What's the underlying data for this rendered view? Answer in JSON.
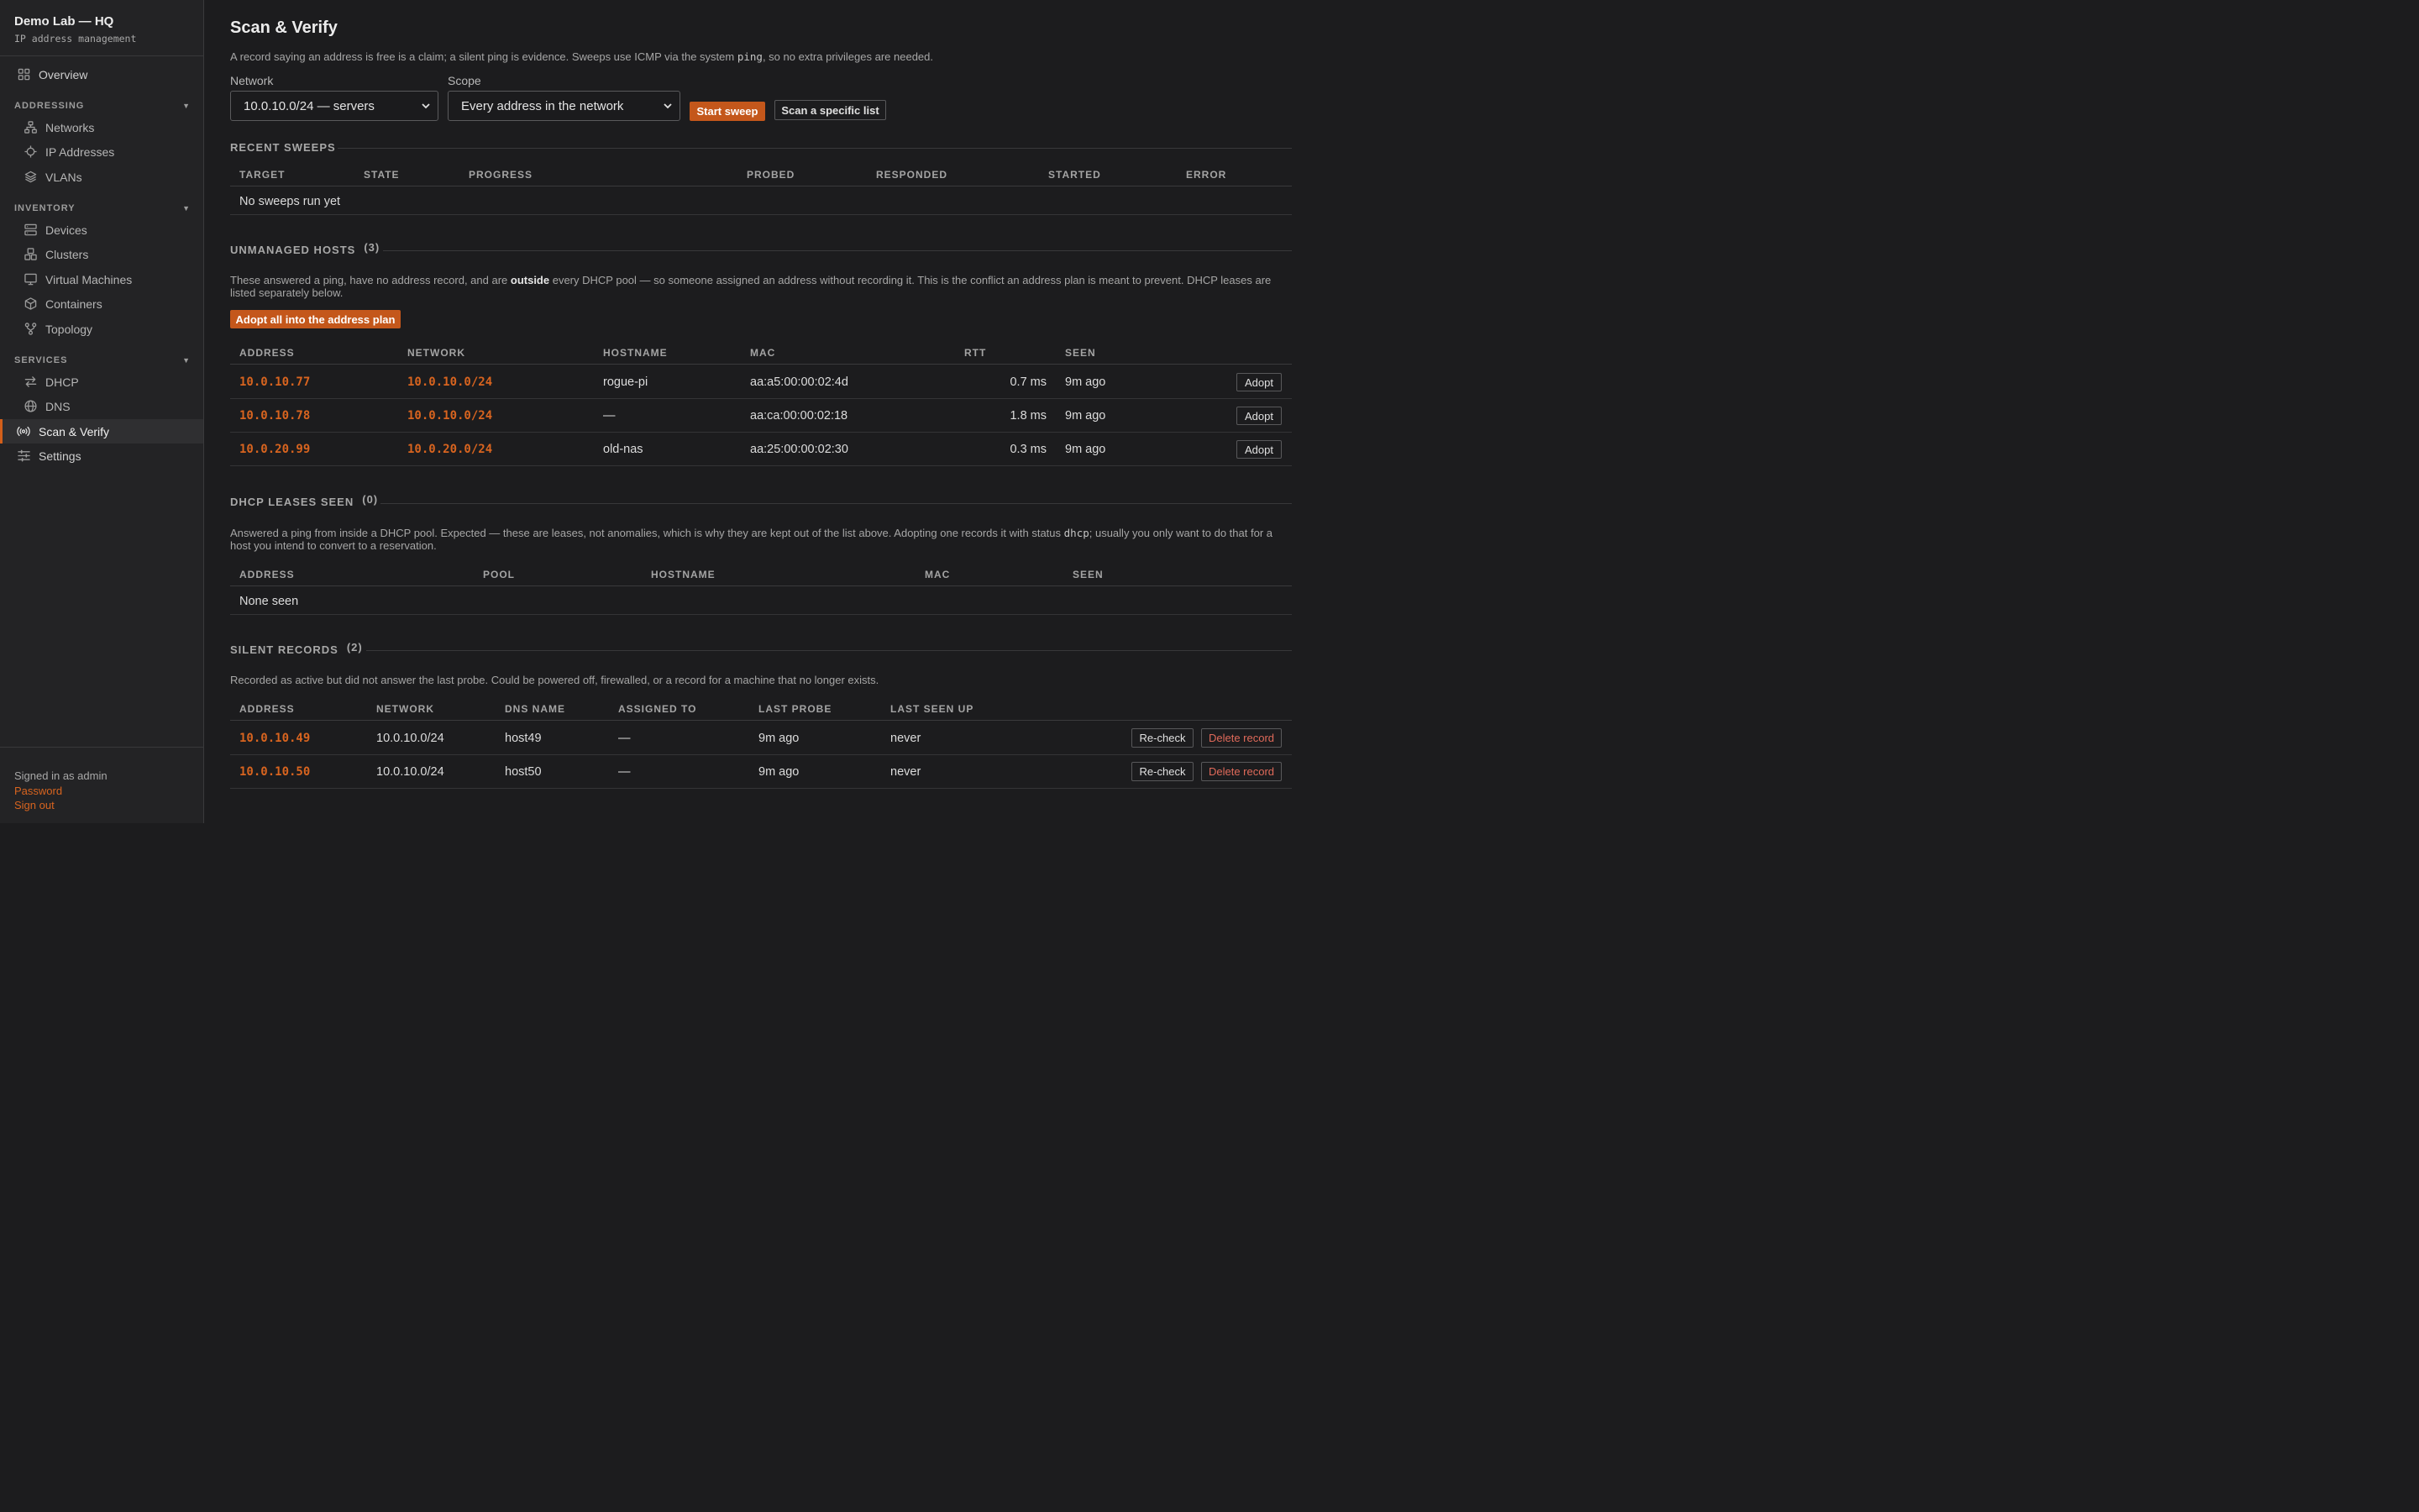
{
  "app": {
    "title": "Demo Lab — HQ",
    "subtitle": "IP address management"
  },
  "sidebar": {
    "overview": "Overview",
    "sections": {
      "addressing": "ADDRESSING",
      "inventory": "INVENTORY",
      "services": "SERVICES"
    },
    "caret": "▼",
    "items": {
      "networks": "Networks",
      "ip_addresses": "IP Addresses",
      "vlans": "VLANs",
      "devices": "Devices",
      "clusters": "Clusters",
      "virtual_machines": "Virtual Machines",
      "containers": "Containers",
      "topology": "Topology",
      "dhcp": "DHCP",
      "dns": "DNS",
      "scan_verify": "Scan & Verify",
      "settings": "Settings"
    },
    "footer": {
      "signed_in": "Signed in as admin",
      "password": "Password",
      "sign_out": "Sign out"
    }
  },
  "page": {
    "title": "Scan & Verify",
    "intro_pre": "A record saying an address is free is a claim; a silent ping is evidence. Sweeps use ICMP via the system ",
    "intro_code": "ping",
    "intro_post": ", so no extra privileges are needed.",
    "network_label": "Network",
    "network_value": "10.0.10.0/24 — servers",
    "scope_label": "Scope",
    "scope_value": "Every address in the network",
    "start_sweep": "Start sweep",
    "scan_list": "Scan a specific list"
  },
  "recent_sweeps": {
    "title": "RECENT SWEEPS",
    "columns": [
      "TARGET",
      "STATE",
      "PROGRESS",
      "PROBED",
      "RESPONDED",
      "STARTED",
      "ERROR"
    ],
    "empty": "No sweeps run yet"
  },
  "unmanaged": {
    "title": "UNMANAGED HOSTS",
    "count": "(3)",
    "desc_pre": "These answered a ping, have no address record, and are ",
    "desc_bold": "outside",
    "desc_post": " every DHCP pool — so someone assigned an address without recording it. This is the conflict an address plan is meant to prevent. DHCP leases are listed separately below.",
    "adopt_all": "Adopt all into the address plan",
    "columns": [
      "ADDRESS",
      "NETWORK",
      "HOSTNAME",
      "MAC",
      "RTT",
      "SEEN"
    ],
    "adopt_label": "Adopt",
    "rows": [
      {
        "address": "10.0.10.77",
        "network": "10.0.10.0/24",
        "hostname": "rogue-pi",
        "mac": "aa:a5:00:00:02:4d",
        "rtt": "0.7 ms",
        "seen": "9m ago"
      },
      {
        "address": "10.0.10.78",
        "network": "10.0.10.0/24",
        "hostname": "—",
        "mac": "aa:ca:00:00:02:18",
        "rtt": "1.8 ms",
        "seen": "9m ago"
      },
      {
        "address": "10.0.20.99",
        "network": "10.0.20.0/24",
        "hostname": "old-nas",
        "mac": "aa:25:00:00:02:30",
        "rtt": "0.3 ms",
        "seen": "9m ago"
      }
    ]
  },
  "dhcp_leases": {
    "title": "DHCP LEASES SEEN",
    "count": "(0)",
    "desc_pre": "Answered a ping from inside a DHCP pool. Expected — these are leases, not anomalies, which is why they are kept out of the list above. Adopting one records it with status ",
    "desc_code": "dhcp",
    "desc_post": "; usually you only want to do that for a host you intend to convert to a reservation.",
    "columns": [
      "ADDRESS",
      "POOL",
      "HOSTNAME",
      "MAC",
      "SEEN"
    ],
    "empty": "None seen"
  },
  "silent": {
    "title": "SILENT RECORDS",
    "count": "(2)",
    "desc": "Recorded as active but did not answer the last probe. Could be powered off, firewalled, or a record for a machine that no longer exists.",
    "columns": [
      "ADDRESS",
      "NETWORK",
      "DNS NAME",
      "ASSIGNED TO",
      "LAST PROBE",
      "LAST SEEN UP"
    ],
    "recheck_label": "Re-check",
    "delete_label": "Delete record",
    "rows": [
      {
        "address": "10.0.10.49",
        "network": "10.0.10.0/24",
        "dns": "host49",
        "assigned": "—",
        "last_probe": "9m ago",
        "last_up": "never"
      },
      {
        "address": "10.0.10.50",
        "network": "10.0.10.0/24",
        "dns": "host50",
        "assigned": "—",
        "last_probe": "9m ago",
        "last_up": "never"
      }
    ]
  },
  "colors": {
    "accent": "#c4571b",
    "link": "#d8641f",
    "danger": "#e06a5a",
    "background": "#1c1c1e",
    "sidebar": "#232325"
  }
}
